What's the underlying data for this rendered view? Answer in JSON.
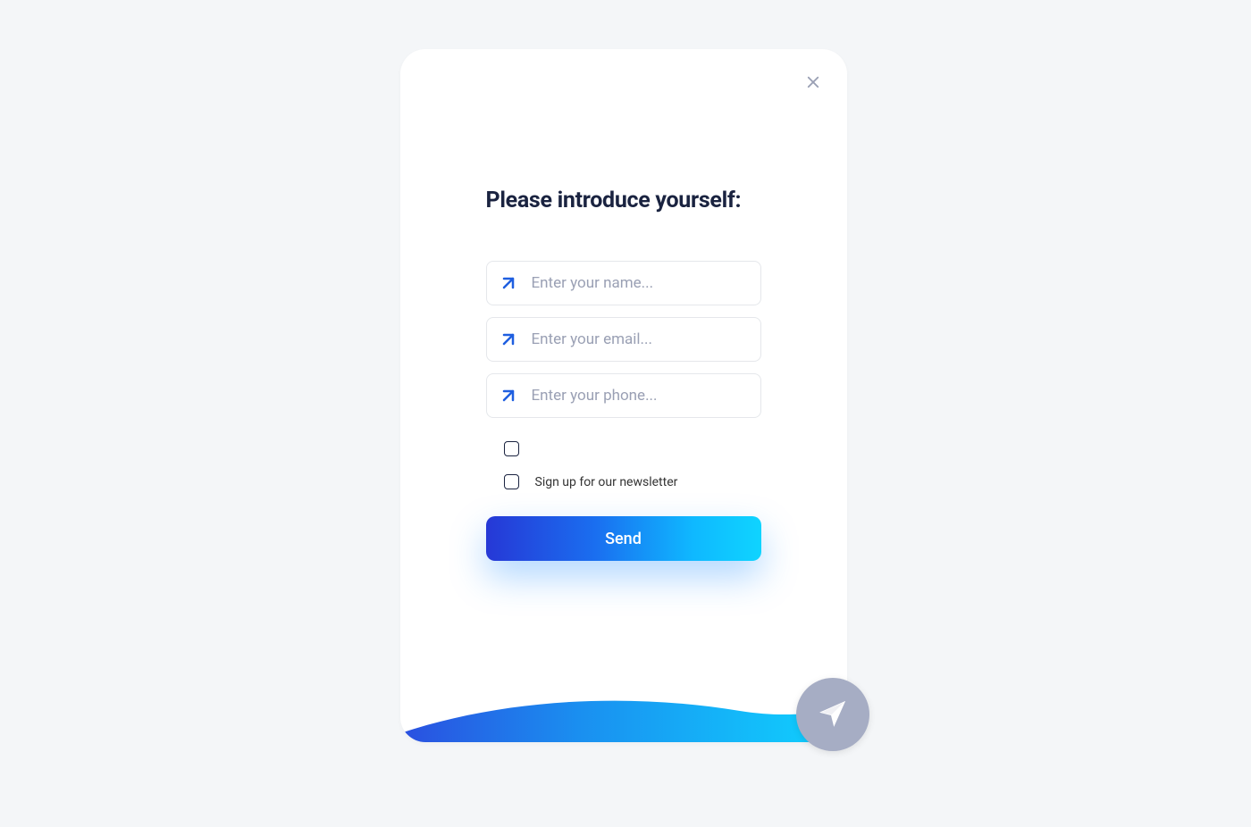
{
  "form": {
    "heading": "Please introduce yourself:",
    "fields": {
      "name": {
        "placeholder": "Enter your name..."
      },
      "email": {
        "placeholder": "Enter your email..."
      },
      "phone": {
        "placeholder": "Enter your phone..."
      }
    },
    "newsletter_label": "Sign up for our newsletter",
    "send_label": "Send"
  },
  "icons": {
    "close": "close-icon",
    "field_marker": "arrow-down-right-icon",
    "fab": "send-icon"
  },
  "colors": {
    "heading": "#1a2340",
    "placeholder": "#9aa0b4",
    "icon_blue": "#1f5fe0",
    "gradient_start": "#2638d6",
    "gradient_end": "#0fd4ff",
    "fab_bg": "#a6adc4"
  }
}
